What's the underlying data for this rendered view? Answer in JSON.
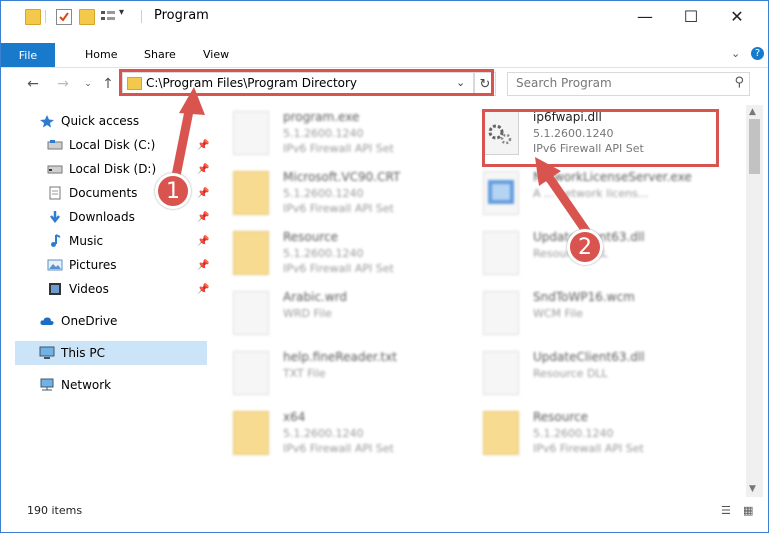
{
  "window": {
    "title": "Program",
    "minimize_glyph": "—",
    "maximize_glyph": "☐",
    "close_glyph": "✕"
  },
  "ribbon": {
    "file": "File",
    "home": "Home",
    "share": "Share",
    "view": "View",
    "expand_glyph": "⌄",
    "help_glyph": "?"
  },
  "address": {
    "path": "C:\\Program Files\\Program Directory",
    "search_placeholder": "Search Program"
  },
  "sidebar": {
    "items": [
      {
        "label": "Quick access",
        "icon": "star-icon"
      },
      {
        "label": "Local Disk (C:)",
        "icon": "drive-icon"
      },
      {
        "label": "Local Disk (D:)",
        "icon": "drive-icon"
      },
      {
        "label": "Documents",
        "icon": "documents-icon"
      },
      {
        "label": "Downloads",
        "icon": "download-icon"
      },
      {
        "label": "Music",
        "icon": "music-icon"
      },
      {
        "label": "Pictures",
        "icon": "pictures-icon"
      },
      {
        "label": "Videos",
        "icon": "videos-icon"
      },
      {
        "label": "OneDrive",
        "icon": "cloud-icon"
      },
      {
        "label": "This PC",
        "icon": "computer-icon"
      },
      {
        "label": "Network",
        "icon": "network-icon"
      }
    ]
  },
  "files": [
    {
      "name": "program.exe",
      "line1": "5.1.2600.1240",
      "line2": "IPv6 Firewall API Set",
      "icon": "exe-icon"
    },
    {
      "name": "ip6fwapi.dll",
      "line1": "5.1.2600.1240",
      "line2": "IPv6 Firewall API Set",
      "icon": "dll-gear-icon"
    },
    {
      "name": "Microsoft.VC90.CRT",
      "line1": "5.1.2600.1240",
      "line2": "IPv6 Firewall API Set",
      "icon": "folder-icon"
    },
    {
      "name": "NetworkLicenseServer.exe",
      "line1": "A ... network licens...",
      "line2": "",
      "icon": "app-icon"
    },
    {
      "name": "Resource",
      "line1": "5.1.2600.1240",
      "line2": "IPv6 Firewall API Set",
      "icon": "folder-icon"
    },
    {
      "name": "UpdateClient63.dll",
      "line1": "Resource DLL",
      "line2": "",
      "icon": "dll-gear-icon"
    },
    {
      "name": "Arabic.wrd",
      "line1": "WRD File",
      "line2": "",
      "icon": "file-icon"
    },
    {
      "name": "SndToWP16.wcm",
      "line1": "WCM File",
      "line2": "",
      "icon": "file-icon"
    },
    {
      "name": "help.fineReader.txt",
      "line1": "TXT File",
      "line2": "",
      "icon": "file-icon"
    },
    {
      "name": "UpdateClient63.dll",
      "line1": "Resource DLL",
      "line2": "",
      "icon": "dll-gear-icon"
    },
    {
      "name": "x64",
      "line1": "5.1.2600.1240",
      "line2": "IPv6 Firewall API Set",
      "icon": "folder-icon"
    },
    {
      "name": "Resource",
      "line1": "5.1.2600.1240",
      "line2": "IPv6 Firewall API Set",
      "icon": "folder-icon"
    }
  ],
  "status": {
    "items_count": "190 items"
  },
  "callouts": {
    "one": "1",
    "two": "2"
  },
  "colors": {
    "accent": "#1979ca",
    "highlight": "#d9534f",
    "selection": "#cce4f7"
  }
}
